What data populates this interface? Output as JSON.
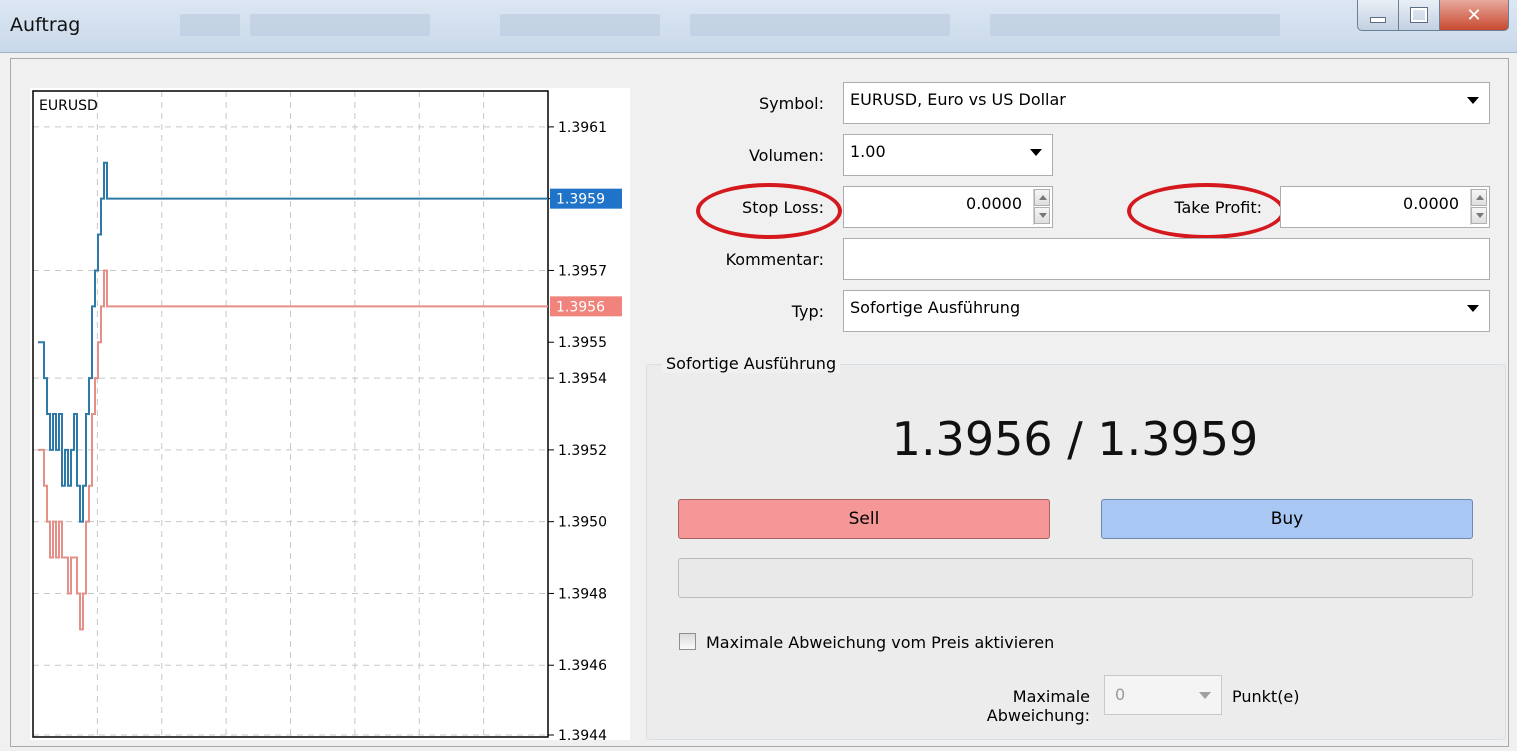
{
  "window": {
    "title": "Auftrag"
  },
  "chart": {
    "symbol": "EURUSD",
    "price_labels": [
      "1.3961",
      "1.3959",
      "1.3957",
      "1.3955",
      "1.3954",
      "1.3952",
      "1.3950",
      "1.3948",
      "1.3946",
      "1.3944"
    ],
    "ask_tag": "1.3959",
    "bid_tag": "1.3956",
    "colors": {
      "ask": "#2d7aa8",
      "bid": "#e48f88",
      "ask_tag_bg": "#1f73c9",
      "bid_tag_bg": "#f0847c"
    }
  },
  "chart_data": {
    "type": "line",
    "title": "EURUSD",
    "ylim": [
      1.3944,
      1.3962
    ],
    "series": [
      {
        "values": [
          1.3955,
          1.3955,
          1.3954,
          1.3953,
          1.3952,
          1.3953,
          1.3952,
          1.3953,
          1.3951,
          1.3952,
          1.3951,
          1.3952,
          1.3953,
          1.3951,
          1.395,
          1.3951,
          1.3953,
          1.3954,
          1.3956,
          1.3957,
          1.3958,
          1.3959,
          1.396,
          1.3959
        ]
      },
      {
        "values": [
          1.3952,
          1.3952,
          1.3951,
          1.395,
          1.3949,
          1.395,
          1.3949,
          1.395,
          1.3949,
          1.3949,
          1.3948,
          1.3949,
          1.3949,
          1.3948,
          1.3947,
          1.3948,
          1.395,
          1.3951,
          1.3953,
          1.3954,
          1.3955,
          1.3956,
          1.3957,
          1.3956
        ]
      }
    ]
  },
  "form": {
    "symbol_label": "Symbol:",
    "symbol_value": "EURUSD, Euro vs US Dollar",
    "volume_label": "Volumen:",
    "volume_value": "1.00",
    "stop_loss_label": "Stop Loss:",
    "stop_loss_value": "0.0000",
    "take_profit_label": "Take Profit:",
    "take_profit_value": "0.0000",
    "comment_label": "Kommentar:",
    "comment_value": "",
    "type_label": "Typ:",
    "type_value": "Sofortige Ausführung"
  },
  "execution": {
    "group_title": "Sofortige Ausführung",
    "quote": "1.3956 / 1.3959",
    "sell_label": "Sell",
    "buy_label": "Buy",
    "deviation_checkbox_label": "Maximale Abweichung vom Preis aktivieren",
    "deviation_checked": false,
    "max_deviation_label": "Maximale Abweichung:",
    "max_deviation_value": "0",
    "points_label": "Punkt(e)"
  }
}
